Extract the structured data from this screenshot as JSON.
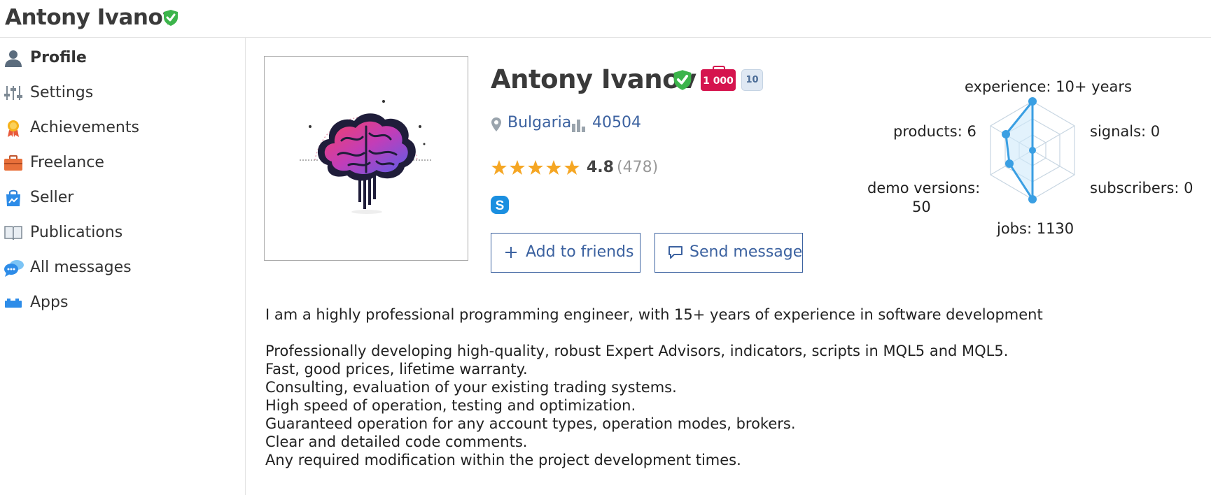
{
  "header": {
    "title": "Antony Ivanov"
  },
  "sidebar": {
    "items": [
      {
        "label": "Profile",
        "icon": "user-icon",
        "active": true
      },
      {
        "label": "Settings",
        "icon": "sliders-icon"
      },
      {
        "label": "Achievements",
        "icon": "medal-icon"
      },
      {
        "label": "Freelance",
        "icon": "briefcase-icon"
      },
      {
        "label": "Seller",
        "icon": "shopping-bag-icon"
      },
      {
        "label": "Publications",
        "icon": "book-icon"
      },
      {
        "label": "All messages",
        "icon": "chat-bubbles-icon"
      },
      {
        "label": "Apps",
        "icon": "apps-icon"
      }
    ]
  },
  "profile": {
    "name": "Antony Ivanov",
    "freelance_badge": "1 000",
    "level_badge": "10",
    "country": "Bulgaria",
    "rank": "40504",
    "rating": "4.8",
    "rating_count": "(478)",
    "stars": 5,
    "add_friend_label": "Add to friends",
    "send_message_label": "Send message"
  },
  "stats": {
    "experience": "experience: 10+ years",
    "signals": "signals: 0",
    "subscribers": "subscribers: 0",
    "jobs": "jobs: 1130",
    "demo_line1": "demo versions:",
    "demo_line2": "50",
    "products": "products: 6"
  },
  "about": {
    "intro": "I am a highly professional programming engineer, with 15+ years of experience in software development",
    "lines": [
      "Professionally developing high-quality, robust Expert Advisors, indicators, scripts in MQL5 and MQL5.",
      "Fast, good prices, lifetime warranty.",
      "Consulting, evaluation of your existing trading systems.",
      "High speed of operation, testing and optimization.",
      "Guaranteed operation for any account types, operation modes, brokers.",
      "Clear and detailed code comments.",
      "Any required modification within the project development times."
    ]
  },
  "colors": {
    "link": "#3c62a0",
    "verified": "#3cb44b",
    "badge": "#d5144e",
    "radar": "#3a9fe3"
  }
}
